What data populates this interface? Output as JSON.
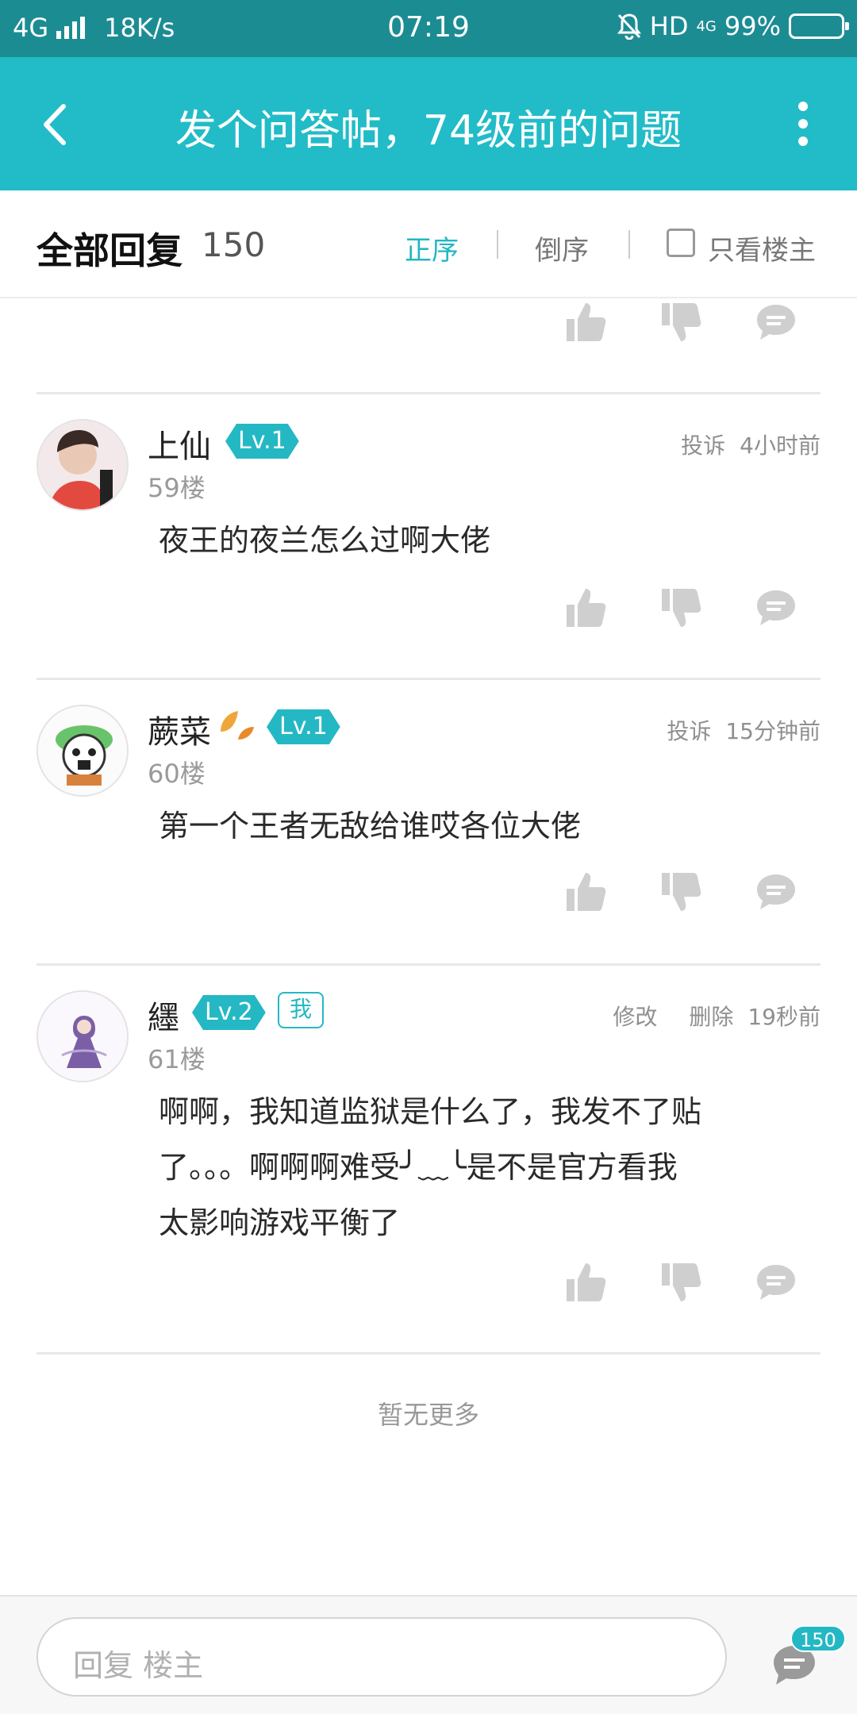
{
  "status_bar": {
    "network": "4G",
    "speed": "18K/s",
    "time": "07:19",
    "hd": "HD",
    "net2": "4G",
    "battery": "99%"
  },
  "header": {
    "title": "发个问答帖，74级前的问题",
    "back_icon": "chevron-left-icon",
    "more_icon": "more-vertical-icon",
    "color": "#21bcc7"
  },
  "sort_bar": {
    "all_label": "全部回复",
    "count": "150",
    "asc_label": "正序",
    "desc_label": "倒序",
    "owner_only_label": "只看楼主",
    "active": "正序"
  },
  "posts": [
    {
      "name": "上仙",
      "level": "Lv.1",
      "floor": "59楼",
      "report": "投诉",
      "time": "4小时前",
      "text": "夜王的夜兰怎么过啊大佬"
    },
    {
      "name": "蕨菜",
      "level": "Lv.1",
      "floor": "60楼",
      "report": "投诉",
      "time": "15分钟前",
      "text": "第一个王者无敌给谁哎各位大佬"
    },
    {
      "name": "纆",
      "level": "Lv.2",
      "me_tag": "我",
      "floor": "61楼",
      "edit": "修改",
      "delete": "删除",
      "time": "19秒前",
      "text_lines": [
        "啊啊，我知道监狱是什么了，我发不了贴",
        "了。。。啊啊啊难受╯﹏╰是不是官方看我",
        "太影响游戏平衡了"
      ]
    }
  ],
  "no_more": "暂无更多",
  "bottom": {
    "reply_placeholder": "回复  楼主",
    "comment_count": "150"
  }
}
